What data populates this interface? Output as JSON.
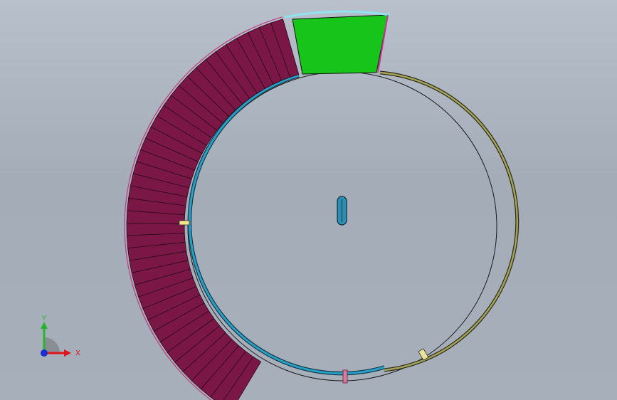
{
  "triad": {
    "x_label": "X",
    "y_label": "Y"
  },
  "colors": {
    "background_top": "#b8c0cb",
    "background_bottom": "#a7afbb",
    "segments": "#7b1747",
    "green_section": "#16c41a",
    "blue_rail": "#27a0c8",
    "olive_rail": "#a6a45a",
    "outline": "#111111",
    "triad_x": "#e0151b",
    "triad_y": "#26b62b",
    "triad_z": "#1a2fd0"
  },
  "scene": {
    "segment_count": 40
  }
}
